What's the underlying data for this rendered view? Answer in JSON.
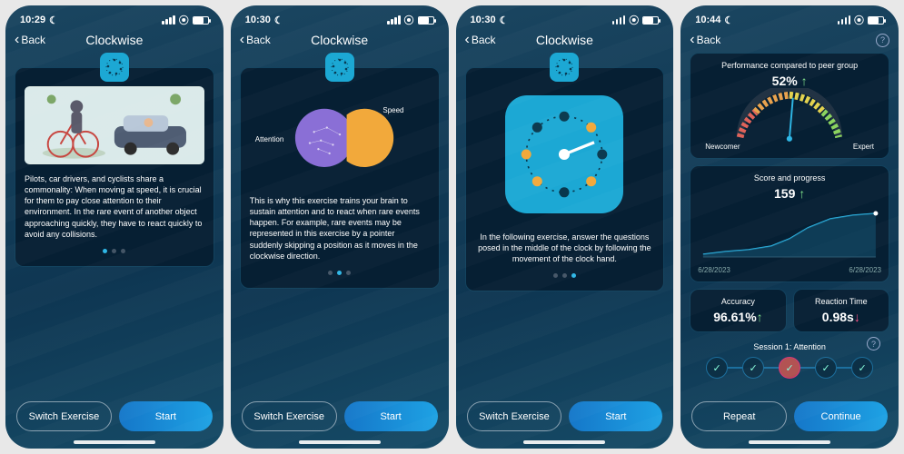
{
  "screens": [
    {
      "time": "10:29",
      "title": "Clockwise",
      "back": "Back",
      "body": "Pilots, car drivers, and cyclists share a commonality: When moving at speed, it is crucial for them to pay close attention to their environment. In the rare event of another object approaching quickly, they have to react quickly to avoid any collisions.",
      "dots": [
        true,
        false,
        false
      ],
      "btnL": "Switch Exercise",
      "btnR": "Start"
    },
    {
      "time": "10:30",
      "title": "Clockwise",
      "back": "Back",
      "venn": {
        "left": "Attention",
        "right": "Speed"
      },
      "body": "This is why this exercise trains your brain to sustain attention and to react when rare events happen. For example, rare events may be represented in this exercise by a pointer suddenly skipping a position as it moves in the clockwise direction.",
      "dots": [
        false,
        true,
        false
      ],
      "btnL": "Switch Exercise",
      "btnR": "Start"
    },
    {
      "time": "10:30",
      "title": "Clockwise",
      "back": "Back",
      "body": "In the following exercise, answer the questions posed in the middle of the clock by following the movement of the clock hand.",
      "dots": [
        false,
        false,
        true
      ],
      "btnL": "Switch Exercise",
      "btnR": "Start"
    },
    {
      "time": "10:44",
      "back": "Back",
      "perf": {
        "label": "Performance compared to peer group",
        "value": "52%",
        "low": "Newcomer",
        "high": "Expert"
      },
      "score": {
        "label": "Score and progress",
        "value": "159",
        "x0": "6/28/2023",
        "x1": "6/28/2023"
      },
      "acc": {
        "label": "Accuracy",
        "value": "96.61%"
      },
      "rt": {
        "label": "Reaction Time",
        "value": "0.98s"
      },
      "session": "Session 1: Attention",
      "btnL": "Repeat",
      "btnR": "Continue"
    }
  ],
  "chart_data": [
    {
      "type": "bar",
      "title": "Performance compared to peer group",
      "categories": [
        "Newcomer",
        "Expert"
      ],
      "values": [
        52
      ],
      "ylim": [
        0,
        100
      ]
    },
    {
      "type": "line",
      "title": "Score and progress",
      "x": [
        "6/28/2023",
        "6/28/2023"
      ],
      "values": [
        20,
        159
      ],
      "ylim": [
        0,
        180
      ]
    }
  ]
}
